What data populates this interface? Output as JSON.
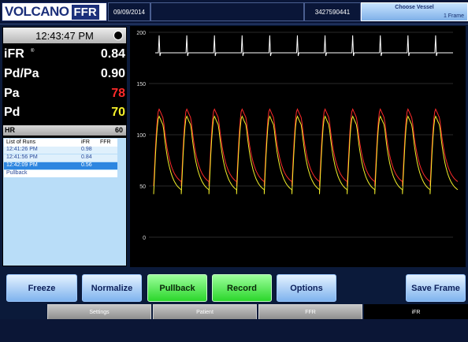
{
  "header": {
    "brand_name": "VOLCANO",
    "brand_product": "FFR",
    "date": "09/09/2014",
    "patient_id": "3427590441",
    "vessel_button": "Choose Vessel",
    "frame_count": "1 Frame"
  },
  "readout": {
    "time": "12:43:47 PM",
    "ifr_label": "iFR",
    "ifr_marker": "®",
    "ifr_value": "0.84",
    "pdpa_label": "Pd/Pa",
    "pdpa_value": "0.90",
    "pa_label": "Pa",
    "pa_value": "78",
    "pa_color": "#ff2a2a",
    "pd_label": "Pd",
    "pd_value": "70",
    "pd_color": "#f4f02a",
    "hr_label": "HR",
    "hr_value": "60"
  },
  "runs": {
    "title": "List of Runs",
    "col_ifr": "iFR",
    "col_ffr": "FFR",
    "rows": [
      {
        "time": "12:41:26 PM",
        "ifr": "0.98",
        "selected": false
      },
      {
        "time": "12:41:56 PM",
        "ifr": "0.84",
        "selected": false
      },
      {
        "time": "12:42:09 PM",
        "ifr": "0.56",
        "selected": true
      }
    ],
    "pullback_label": "Pullback"
  },
  "chart_data": {
    "type": "line",
    "y_ticks": [
      "200",
      "150",
      "100",
      "50",
      "0"
    ],
    "ylim": [
      0,
      200
    ],
    "grid": true,
    "beats": 11,
    "ecg_color": "#ffffff",
    "series": [
      {
        "color": "#ff2a2a",
        "peak": 125,
        "trough": 50,
        "values": [
          125,
          50
        ]
      },
      {
        "color": "#f4f02a",
        "peak": 118,
        "trough": 42,
        "values": [
          118,
          42
        ]
      }
    ]
  },
  "buttons": {
    "freeze": "Freeze",
    "normalize": "Normalize",
    "pullback": "Pullback",
    "record": "Record",
    "options": "Options",
    "save_frame": "Save Frame"
  },
  "tabs": [
    "Settings",
    "Patient",
    "FFR",
    "iFR"
  ]
}
